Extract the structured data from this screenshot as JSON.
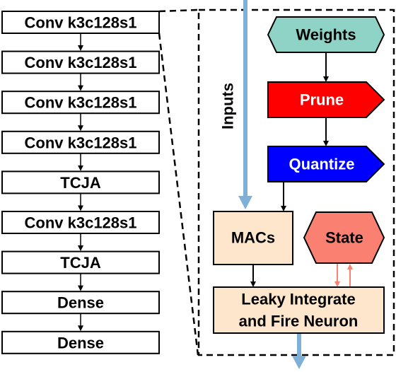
{
  "layers": [
    "Conv k3c128s1",
    "Conv k3c128s1",
    "Conv k3c128s1",
    "Conv k3c128s1",
    "TCJA",
    "Conv k3c128s1",
    "TCJA",
    "Dense",
    "Dense"
  ],
  "detail": {
    "inputs_label": "Inputs",
    "weights": "Weights",
    "prune": "Prune",
    "quantize": "Quantize",
    "macs": "MACs",
    "state": "State",
    "lif_line1": "Leaky Integrate",
    "lif_line2": "and Fire Neuron"
  },
  "colors": {
    "weights": "#8fd3c7",
    "prune": "#ff0000",
    "quantize": "#0000ff",
    "macs": "#fde6cc",
    "state": "#fa8072",
    "data_flow": "#7fb0d5"
  }
}
